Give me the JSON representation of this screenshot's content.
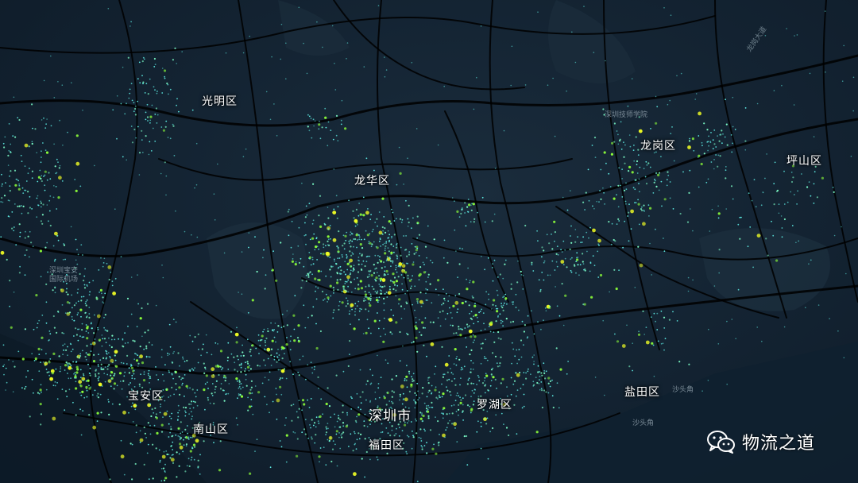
{
  "map": {
    "theme": "dark",
    "background_color": "#142433",
    "road_color": "#000000",
    "point_colors": [
      "#5ff0e8",
      "#7dffc8",
      "#8cff3a",
      "#f2ff24"
    ],
    "districts": [
      {
        "id": "guangming",
        "label": "光明区"
      },
      {
        "id": "longhua",
        "label": "龙华区"
      },
      {
        "id": "longgang",
        "label": "龙岗区"
      },
      {
        "id": "pingshan",
        "label": "坪山区"
      },
      {
        "id": "baoan",
        "label": "宝安区"
      },
      {
        "id": "nanshan",
        "label": "南山区"
      },
      {
        "id": "futian",
        "label": "福田区"
      },
      {
        "id": "luohu",
        "label": "罗湖区"
      },
      {
        "id": "yantian",
        "label": "盐田区"
      }
    ],
    "city_label": "深圳市",
    "poi_labels": [
      {
        "id": "airport",
        "label": "深圳宝安\n国际机场"
      },
      {
        "id": "tech-college",
        "label": "深圳技师学院"
      },
      {
        "id": "shatoujiao-1",
        "label": "沙头角"
      },
      {
        "id": "shatoujiao-2",
        "label": "沙头角"
      }
    ],
    "road_labels": [
      {
        "id": "longgang-avenue",
        "label": "龙岗大道"
      }
    ]
  },
  "watermark": {
    "icon": "wechat-icon",
    "text": "物流之道"
  }
}
